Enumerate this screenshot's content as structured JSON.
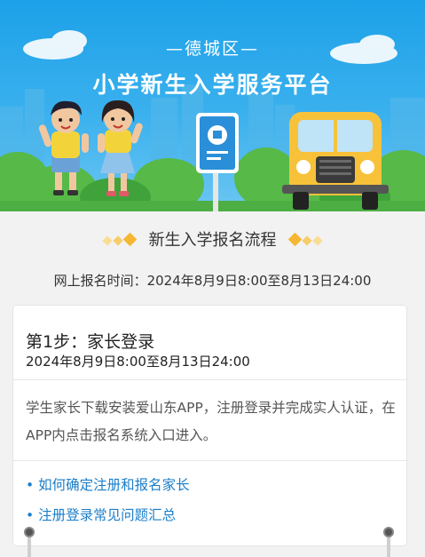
{
  "header": {
    "district": "—德城区—",
    "title": "小学新生入学服务平台"
  },
  "section": {
    "title": "新生入学报名流程",
    "registration_time": "网上报名时间：2024年8月9日8:00至8月13日24:00"
  },
  "step": {
    "title": "第1步：家长登录",
    "time": "2024年8月9日8:00至8月13日24:00",
    "description": "学生家长下载安装爱山东APP，注册登录并完成实人认证，在APP内点击报名系统入口进入。",
    "links": [
      "• 如何确定注册和报名家长",
      "• 注册登录常见问题汇总"
    ]
  },
  "colors": {
    "sky": "#1da1e8",
    "accent_gold": "#f5b731",
    "link": "#1a7ec9",
    "bus_yellow": "#f7c23a",
    "grass": "#57b947"
  }
}
